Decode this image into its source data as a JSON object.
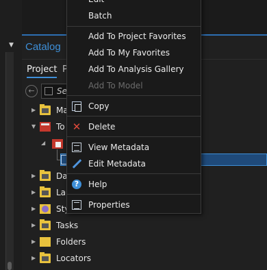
{
  "catalog": {
    "title": "Catalog",
    "tabs": [
      "Project",
      "P"
    ],
    "search_text": "Se"
  },
  "tree": {
    "items": [
      {
        "label": "Ma",
        "icon": "maps-folder-icon"
      },
      {
        "label": "To",
        "icon": "toolboxes-folder-icon"
      },
      {
        "label": "Da",
        "icon": "databases-folder-icon"
      },
      {
        "label": "La",
        "icon": "layouts-folder-icon"
      },
      {
        "label": "Sty",
        "icon": "styles-folder-icon"
      },
      {
        "label": "Tasks",
        "icon": "tasks-folder-icon"
      },
      {
        "label": "Folders",
        "icon": "folders-folder-icon"
      },
      {
        "label": "Locators",
        "icon": "locators-folder-icon"
      }
    ]
  },
  "context_menu": {
    "items": {
      "edit": "Edit",
      "batch": "Batch",
      "add_project_favorites": "Add To Project Favorites",
      "add_my_favorites": "Add To My Favorites",
      "add_analysis_gallery": "Add To Analysis Gallery",
      "add_model": "Add To Model",
      "copy": "Copy",
      "delete": "Delete",
      "view_metadata": "View Metadata",
      "edit_metadata": "Edit Metadata",
      "help": "Help",
      "properties": "Properties"
    },
    "icons": {
      "copy": "copy-icon",
      "delete": "delete-icon",
      "view_metadata": "view-metadata-icon",
      "edit_metadata": "edit-metadata-icon",
      "help": "help-icon",
      "help_glyph": "?",
      "delete_glyph": "✕",
      "properties": "properties-icon"
    }
  },
  "colors": {
    "accent": "#3e8fd8",
    "menu_bg": "#1a1a1a",
    "selection": "#1f4a7a",
    "delete": "#e04a3b",
    "folder": "#e8c23d"
  }
}
